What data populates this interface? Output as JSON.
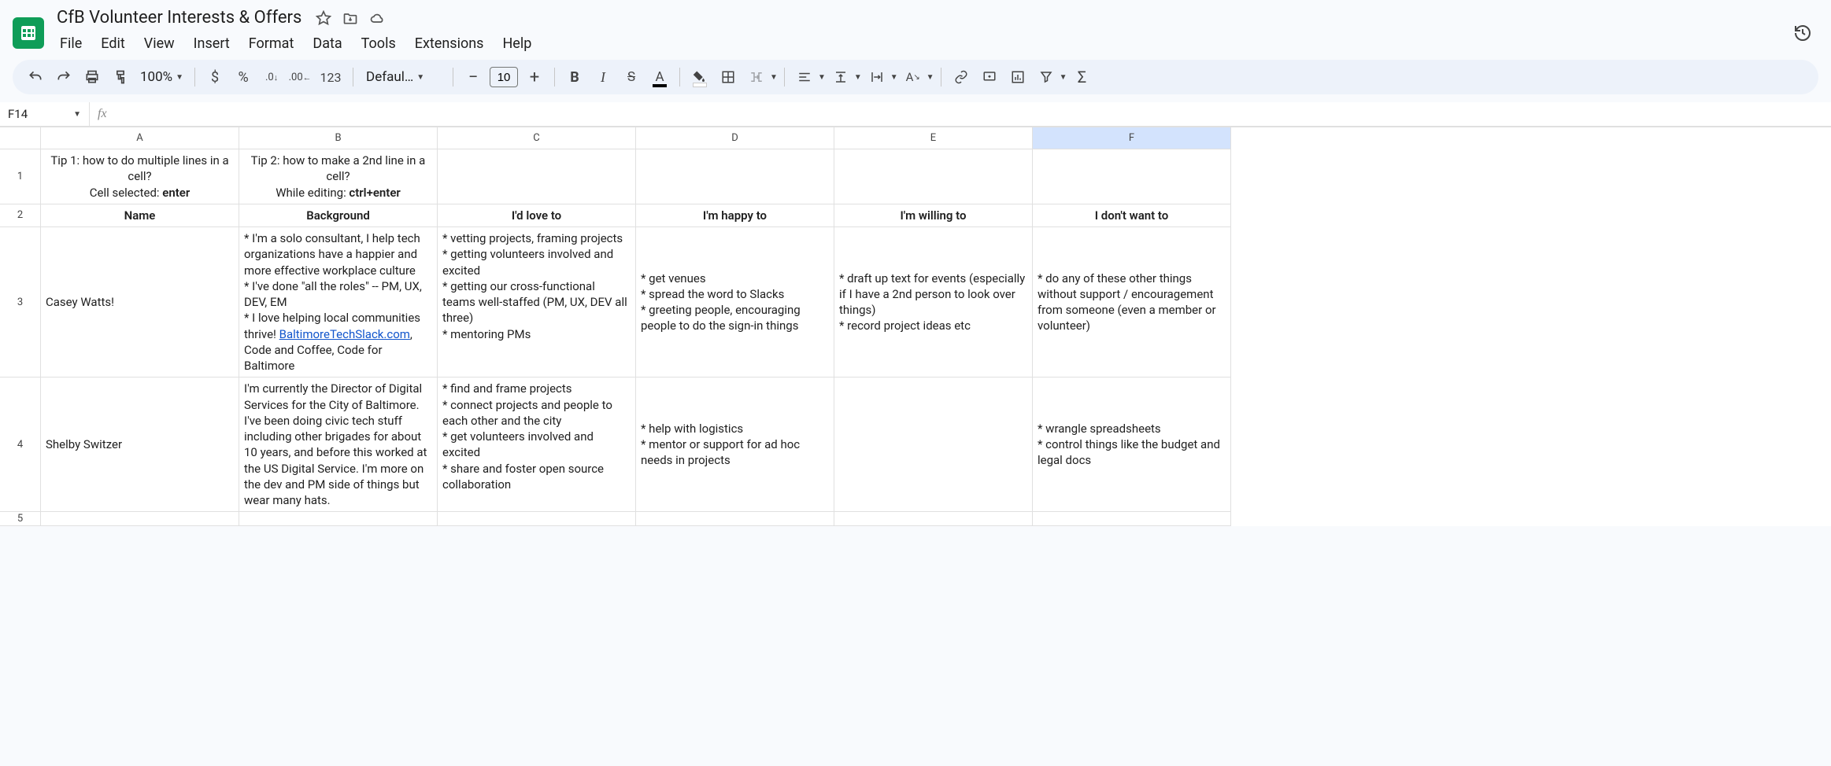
{
  "doc": {
    "title": "CfB Volunteer Interests & Offers"
  },
  "menus": [
    "File",
    "Edit",
    "View",
    "Insert",
    "Format",
    "Data",
    "Tools",
    "Extensions",
    "Help"
  ],
  "toolbar": {
    "zoom": "100%",
    "currency_fmt": "$",
    "percent_fmt": "%",
    "num_fmt": "123",
    "font": "Defaul…",
    "font_size": "10"
  },
  "namebox": "F14",
  "formula_bar": "",
  "columns": [
    "A",
    "B",
    "C",
    "D",
    "E",
    "F"
  ],
  "selected_column": "F",
  "rows": [
    {
      "num": "1",
      "cells": {
        "A": {
          "pre": "Tip 1: how to do multiple lines in a cell?\nCell selected: ",
          "bold": "enter"
        },
        "B": {
          "pre": "Tip 2: how to make a 2nd line in a cell?\nWhile editing: ",
          "bold": "ctrl+enter"
        },
        "C": "",
        "D": "",
        "E": "",
        "F": ""
      }
    },
    {
      "num": "2",
      "header": true,
      "cells": {
        "A": "Name",
        "B": "Background",
        "C": "I'd love to",
        "D": "I'm happy to",
        "E": "I'm willing to",
        "F": "I don't want to"
      }
    },
    {
      "num": "3",
      "cells": {
        "A": "Casey Watts!",
        "B": {
          "pre": "* I'm a solo consultant, I help tech organizations have a happier and more effective workplace culture\n* I've done \"all the roles\" -- PM, UX, DEV, EM\n* I love helping local communities thrive! ",
          "link_text": "BaltimoreTechSlack.com",
          "post": ", Code and Coffee, Code for Baltimore"
        },
        "C": "* vetting projects, framing projects\n* getting volunteers involved and excited\n* getting our cross-functional teams well-staffed (PM, UX, DEV all three)\n* mentoring PMs",
        "D": "* get venues\n* spread the word to Slacks\n* greeting people, encouraging people to do the sign-in things",
        "E": "* draft up text for events (especially if I have a 2nd person to look over things)\n* record project ideas etc",
        "F": "* do any of these other things without support / encouragement from someone (even a member or volunteer)"
      }
    },
    {
      "num": "4",
      "cells": {
        "A": "Shelby Switzer",
        "B": "I'm currently the Director of Digital Services for the City of Baltimore. I've been doing civic tech stuff including other brigades for about 10 years, and before this worked at the US Digital Service. I'm more on the dev and PM side of things but wear many hats.",
        "C": "* find and frame projects\n* connect projects and people to each other and the city\n* get volunteers involved and excited\n* share and foster open source collaboration",
        "D": "* help with logistics\n* mentor or support for ad hoc needs in projects",
        "E": "",
        "F": "* wrangle spreadsheets\n* control things like the budget and legal docs"
      }
    },
    {
      "num": "5",
      "partial": true,
      "cells": {
        "A": "",
        "B": "",
        "C": "",
        "D": "",
        "E": "",
        "F": ""
      }
    }
  ]
}
